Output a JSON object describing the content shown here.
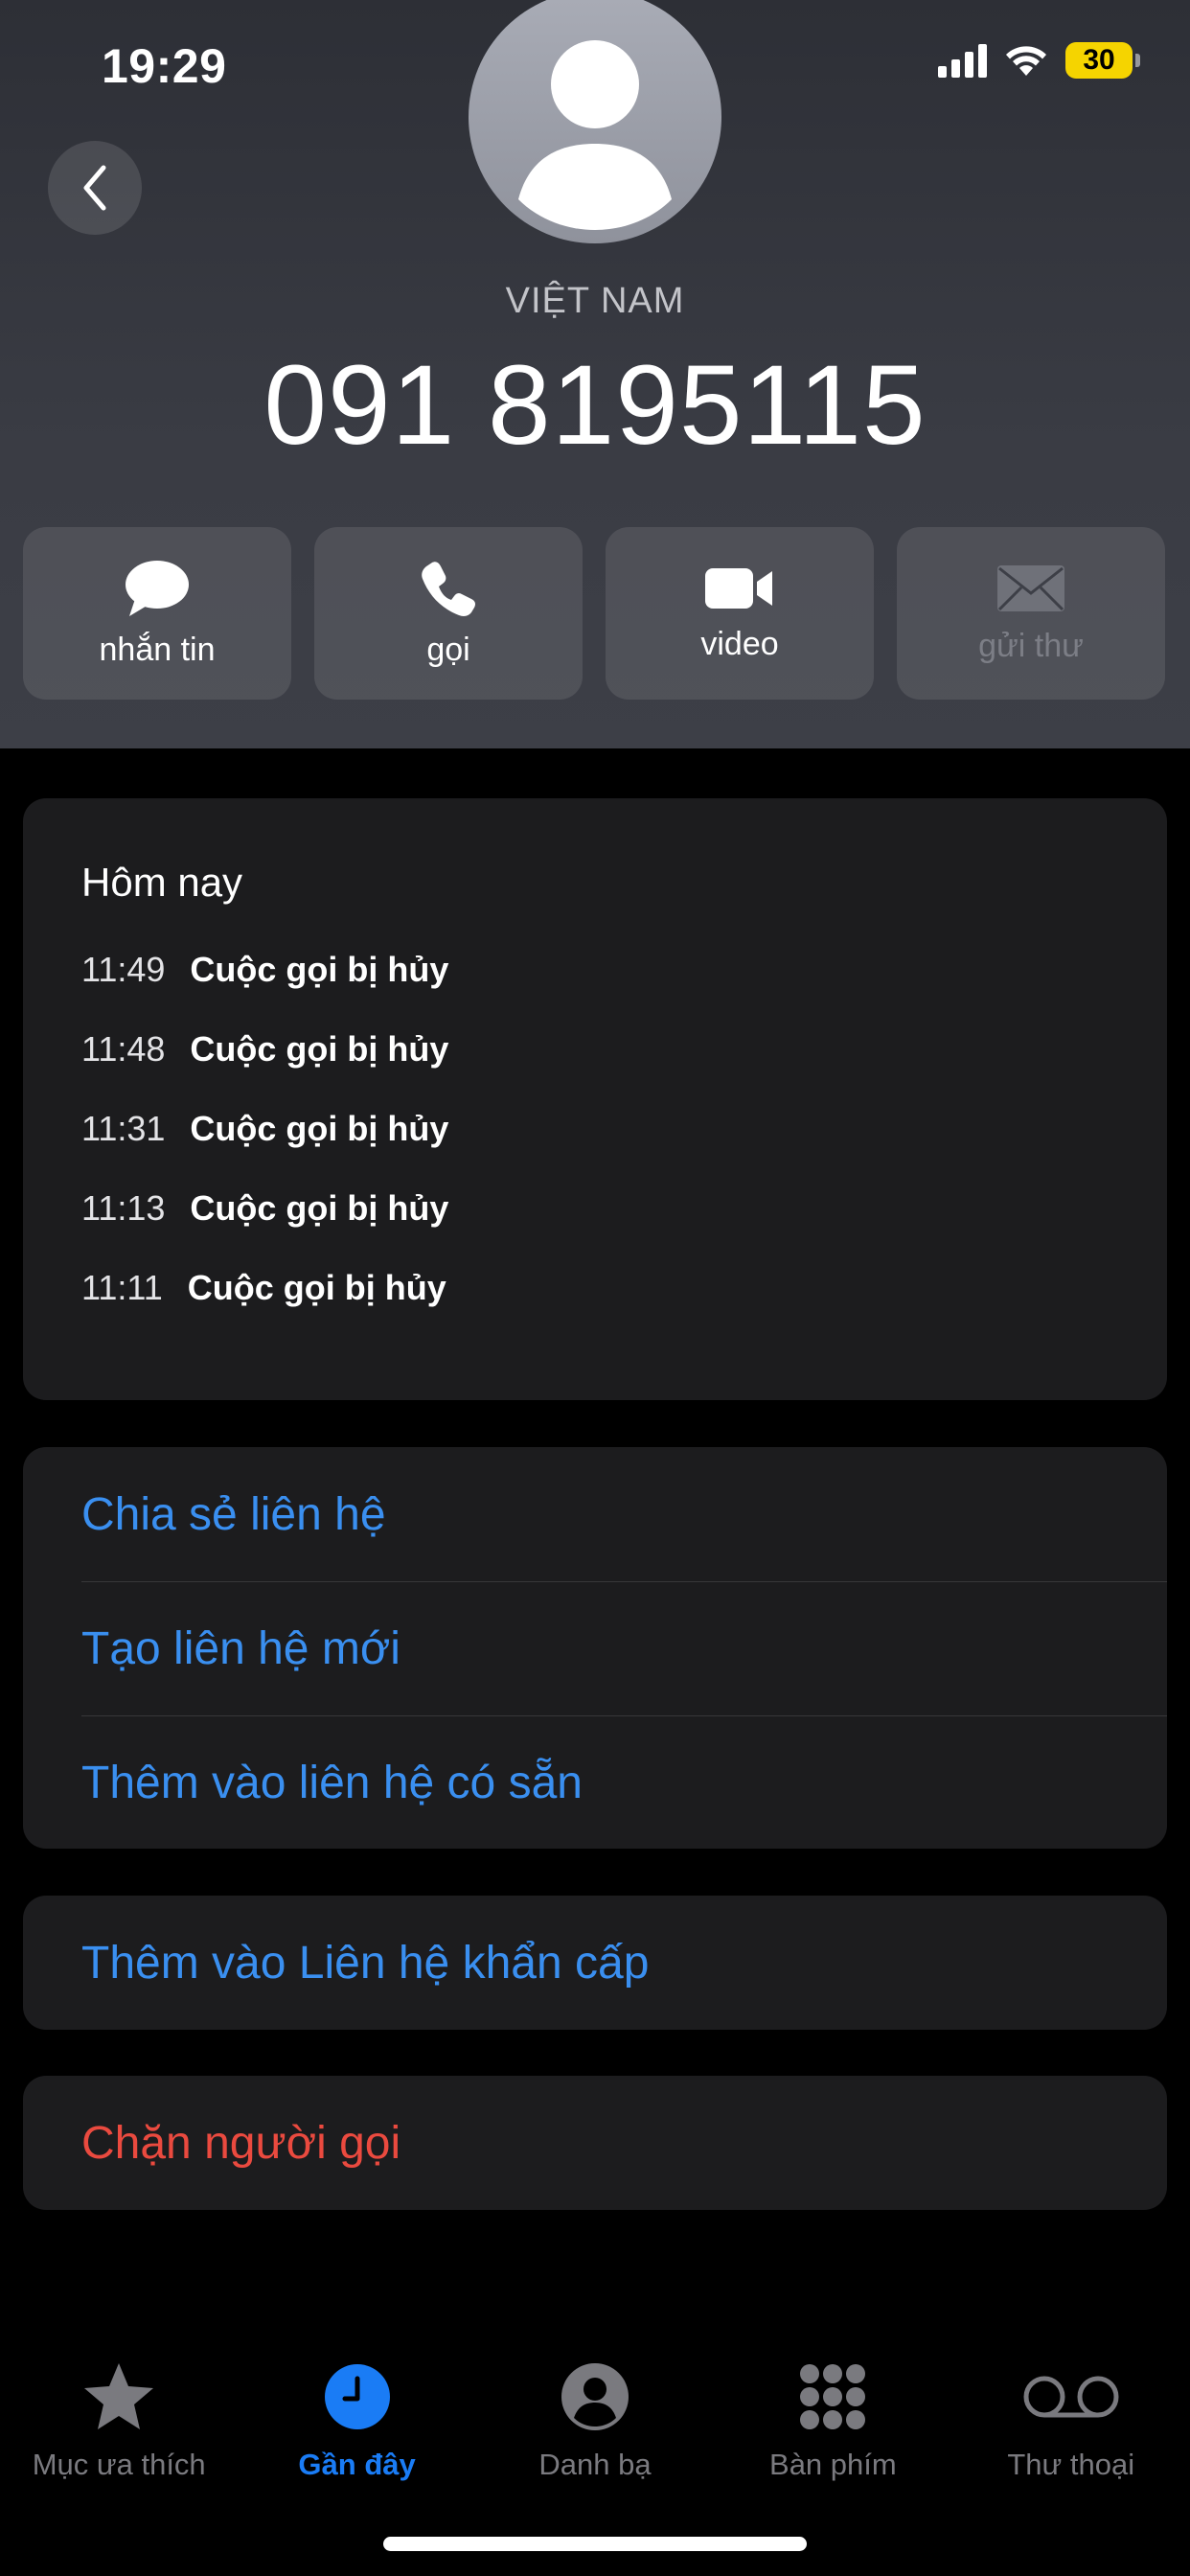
{
  "status_bar": {
    "time": "19:29",
    "battery": "30"
  },
  "contact": {
    "country": "VIỆT NAM",
    "phone": "091 8195115"
  },
  "actions": [
    {
      "label": "nhắn tin",
      "icon": "message-bubble-icon"
    },
    {
      "label": "gọi",
      "icon": "phone-icon"
    },
    {
      "label": "video",
      "icon": "video-camera-icon"
    },
    {
      "label": "gửi thư",
      "icon": "mail-icon",
      "disabled": true
    }
  ],
  "history": {
    "title": "Hôm nay",
    "rows": [
      {
        "time": "11:49",
        "status": "Cuộc gọi bị hủy"
      },
      {
        "time": "11:48",
        "status": "Cuộc gọi bị hủy"
      },
      {
        "time": "11:31",
        "status": "Cuộc gọi bị hủy"
      },
      {
        "time": "11:13",
        "status": "Cuộc gọi bị hủy"
      },
      {
        "time": "11:11",
        "status": "Cuộc gọi bị hủy"
      }
    ]
  },
  "links": {
    "share": "Chia sẻ liên hệ",
    "create": "Tạo liên hệ mới",
    "add_existing": "Thêm vào liên hệ có sẵn",
    "emergency": "Thêm vào Liên hệ khẩn cấp",
    "block": "Chặn người gọi"
  },
  "tabs": [
    {
      "label": "Mục ưa thích",
      "icon": "star-icon"
    },
    {
      "label": "Gần đây",
      "icon": "clock-icon",
      "active": true
    },
    {
      "label": "Danh bạ",
      "icon": "person-circle-icon"
    },
    {
      "label": "Bàn phím",
      "icon": "keypad-icon"
    },
    {
      "label": "Thư thoại",
      "icon": "voicemail-icon"
    }
  ],
  "colors": {
    "accent_blue": "#3a8ff0",
    "tab_active": "#1a7cf5",
    "destructive": "#ea4a3f",
    "battery": "#f5d400"
  }
}
